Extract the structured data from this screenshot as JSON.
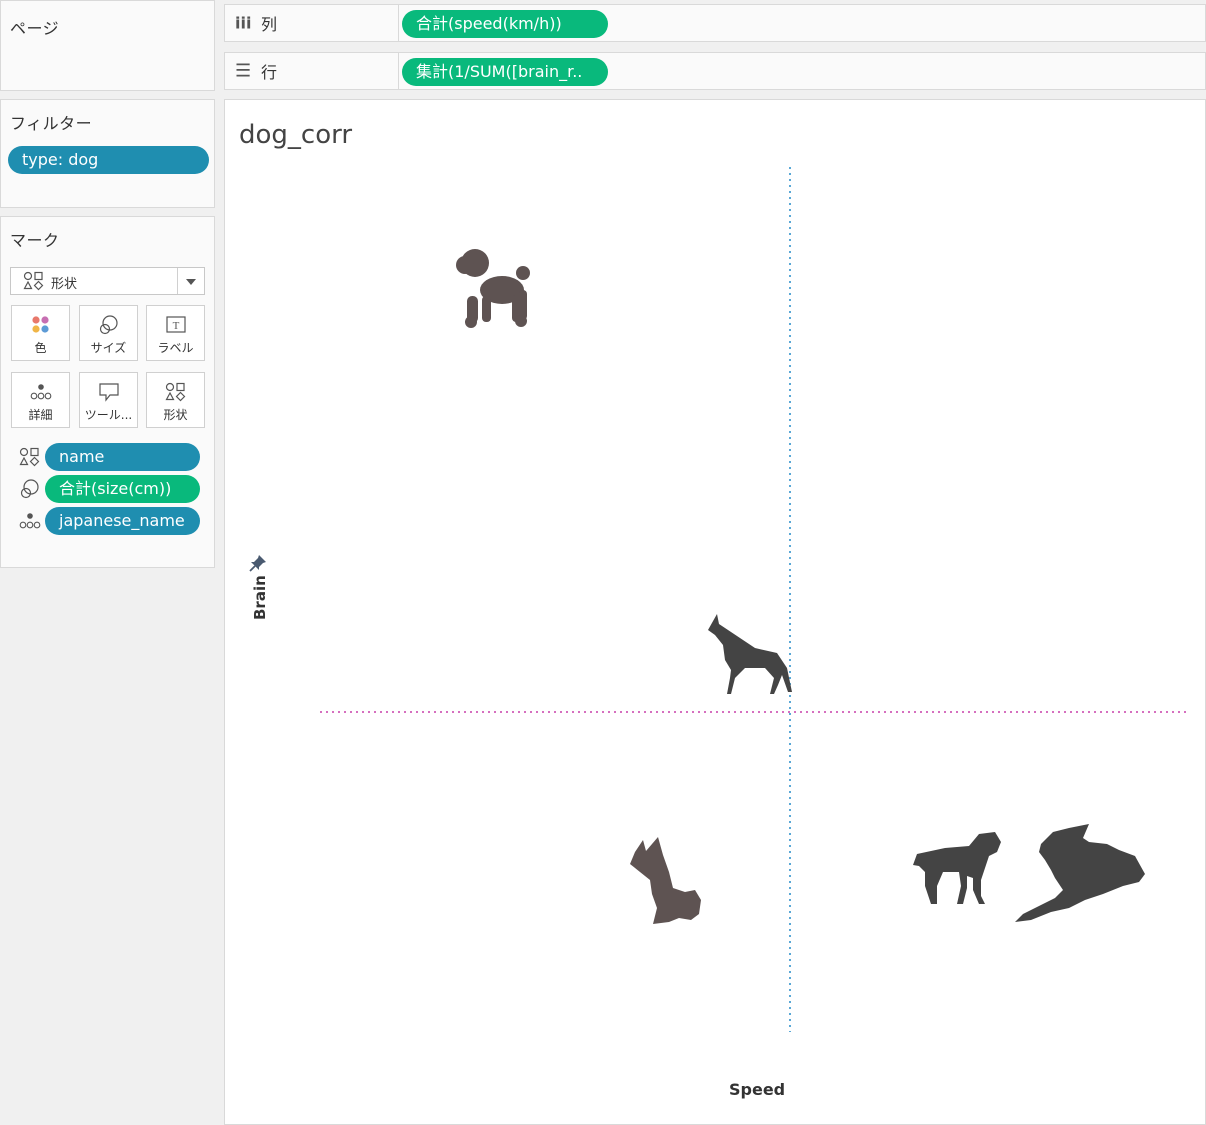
{
  "pages_panel": {
    "title": "ページ"
  },
  "filters_panel": {
    "title": "フィルター",
    "filter_pill": "type: dog"
  },
  "marks_panel": {
    "title": "マーク",
    "mark_type": "形状",
    "buttons": [
      {
        "label": "色",
        "icon": "color-icon"
      },
      {
        "label": "サイズ",
        "icon": "size-icon"
      },
      {
        "label": "ラベル",
        "icon": "label-icon"
      },
      {
        "label": "詳細",
        "icon": "detail-icon"
      },
      {
        "label": "ツール...",
        "icon": "tooltip-icon"
      },
      {
        "label": "形状",
        "icon": "shape-icon"
      }
    ],
    "fields": [
      {
        "label": "name",
        "icon": "shape-icon",
        "color": "#1f8eb0"
      },
      {
        "label": "合計(size(cm))",
        "icon": "size-icon",
        "color": "#09b97c"
      },
      {
        "label": "japanese_name",
        "icon": "detail-icon",
        "color": "#1f8eb0"
      }
    ]
  },
  "shelves": {
    "columns": {
      "label": "列",
      "icon": "iii",
      "pill": "合計(speed(km/h))"
    },
    "rows": {
      "label": "行",
      "icon": "☰",
      "pill": "集計(1/SUM([brain_r.."
    }
  },
  "viz": {
    "title": "dog_corr",
    "x_axis_title": "Speed",
    "y_axis_title": "Brain",
    "ref_line_colors": {
      "vertical": "#5aa8d6",
      "horizontal": "#d66fbf"
    },
    "mark_color": "#4d4d4d"
  }
}
